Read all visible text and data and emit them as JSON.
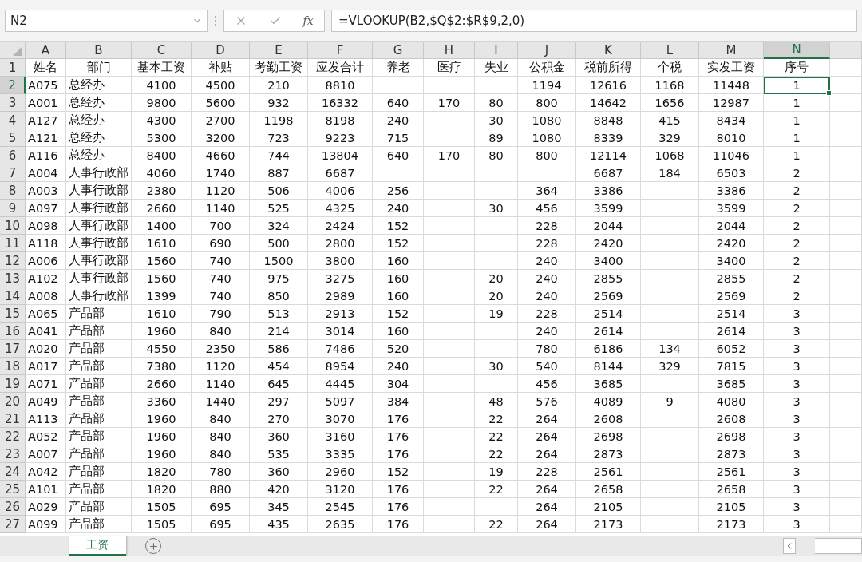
{
  "formula_bar": {
    "name_box": "N2",
    "fx": "fx",
    "formula": "=VLOOKUP(B2,$Q$2:$R$9,2,0)"
  },
  "columns": [
    {
      "letter": "A",
      "selected": false
    },
    {
      "letter": "B",
      "selected": false
    },
    {
      "letter": "C",
      "selected": false
    },
    {
      "letter": "D",
      "selected": false
    },
    {
      "letter": "E",
      "selected": false
    },
    {
      "letter": "F",
      "selected": false
    },
    {
      "letter": "G",
      "selected": false
    },
    {
      "letter": "H",
      "selected": false
    },
    {
      "letter": "I",
      "selected": false
    },
    {
      "letter": "J",
      "selected": false
    },
    {
      "letter": "K",
      "selected": false
    },
    {
      "letter": "L",
      "selected": false
    },
    {
      "letter": "M",
      "selected": false
    },
    {
      "letter": "N",
      "selected": true
    }
  ],
  "rows": [
    {
      "row_number": "1",
      "selected": false,
      "cells": [
        "姓名",
        "部门",
        "基本工资",
        "补贴",
        "考勤工资",
        "应发合计",
        "养老",
        "医疗",
        "失业",
        "公积金",
        "税前所得",
        "个税",
        "实发工资",
        "序号"
      ]
    },
    {
      "row_number": "2",
      "selected": true,
      "cells": [
        "A075",
        "总经办",
        "4100",
        "4500",
        "210",
        "8810",
        null,
        null,
        null,
        "1194",
        "12616",
        "1168",
        "11448",
        "1"
      ]
    },
    {
      "row_number": "3",
      "selected": false,
      "cells": [
        "A001",
        "总经办",
        "9800",
        "5600",
        "932",
        "16332",
        "640",
        "170",
        "80",
        "800",
        "14642",
        "1656",
        "12987",
        "1"
      ]
    },
    {
      "row_number": "4",
      "selected": false,
      "cells": [
        "A127",
        "总经办",
        "4300",
        "2700",
        "1198",
        "8198",
        "240",
        null,
        "30",
        "1080",
        "8848",
        "415",
        "8434",
        "1"
      ]
    },
    {
      "row_number": "5",
      "selected": false,
      "cells": [
        "A121",
        "总经办",
        "5300",
        "3200",
        "723",
        "9223",
        "715",
        null,
        "89",
        "1080",
        "8339",
        "329",
        "8010",
        "1"
      ]
    },
    {
      "row_number": "6",
      "selected": false,
      "cells": [
        "A116",
        "总经办",
        "8400",
        "4660",
        "744",
        "13804",
        "640",
        "170",
        "80",
        "800",
        "12114",
        "1068",
        "11046",
        "1"
      ]
    },
    {
      "row_number": "7",
      "selected": false,
      "cells": [
        "A004",
        "人事行政部",
        "4060",
        "1740",
        "887",
        "6687",
        null,
        null,
        null,
        null,
        "6687",
        "184",
        "6503",
        "2"
      ]
    },
    {
      "row_number": "8",
      "selected": false,
      "cells": [
        "A003",
        "人事行政部",
        "2380",
        "1120",
        "506",
        "4006",
        "256",
        null,
        null,
        "364",
        "3386",
        null,
        "3386",
        "2"
      ]
    },
    {
      "row_number": "9",
      "selected": false,
      "cells": [
        "A097",
        "人事行政部",
        "2660",
        "1140",
        "525",
        "4325",
        "240",
        null,
        "30",
        "456",
        "3599",
        null,
        "3599",
        "2"
      ]
    },
    {
      "row_number": "10",
      "selected": false,
      "cells": [
        "A098",
        "人事行政部",
        "1400",
        "700",
        "324",
        "2424",
        "152",
        null,
        null,
        "228",
        "2044",
        null,
        "2044",
        "2"
      ]
    },
    {
      "row_number": "11",
      "selected": false,
      "cells": [
        "A118",
        "人事行政部",
        "1610",
        "690",
        "500",
        "2800",
        "152",
        null,
        null,
        "228",
        "2420",
        null,
        "2420",
        "2"
      ]
    },
    {
      "row_number": "12",
      "selected": false,
      "cells": [
        "A006",
        "人事行政部",
        "1560",
        "740",
        "1500",
        "3800",
        "160",
        null,
        null,
        "240",
        "3400",
        null,
        "3400",
        "2"
      ]
    },
    {
      "row_number": "13",
      "selected": false,
      "cells": [
        "A102",
        "人事行政部",
        "1560",
        "740",
        "975",
        "3275",
        "160",
        null,
        "20",
        "240",
        "2855",
        null,
        "2855",
        "2"
      ]
    },
    {
      "row_number": "14",
      "selected": false,
      "cells": [
        "A008",
        "人事行政部",
        "1399",
        "740",
        "850",
        "2989",
        "160",
        null,
        "20",
        "240",
        "2569",
        null,
        "2569",
        "2"
      ]
    },
    {
      "row_number": "15",
      "selected": false,
      "cells": [
        "A065",
        "产品部",
        "1610",
        "790",
        "513",
        "2913",
        "152",
        null,
        "19",
        "228",
        "2514",
        null,
        "2514",
        "3"
      ]
    },
    {
      "row_number": "16",
      "selected": false,
      "cells": [
        "A041",
        "产品部",
        "1960",
        "840",
        "214",
        "3014",
        "160",
        null,
        null,
        "240",
        "2614",
        null,
        "2614",
        "3"
      ]
    },
    {
      "row_number": "17",
      "selected": false,
      "cells": [
        "A020",
        "产品部",
        "4550",
        "2350",
        "586",
        "7486",
        "520",
        null,
        null,
        "780",
        "6186",
        "134",
        "6052",
        "3"
      ]
    },
    {
      "row_number": "18",
      "selected": false,
      "cells": [
        "A017",
        "产品部",
        "7380",
        "1120",
        "454",
        "8954",
        "240",
        null,
        "30",
        "540",
        "8144",
        "329",
        "7815",
        "3"
      ]
    },
    {
      "row_number": "19",
      "selected": false,
      "cells": [
        "A071",
        "产品部",
        "2660",
        "1140",
        "645",
        "4445",
        "304",
        null,
        null,
        "456",
        "3685",
        null,
        "3685",
        "3"
      ]
    },
    {
      "row_number": "20",
      "selected": false,
      "cells": [
        "A049",
        "产品部",
        "3360",
        "1440",
        "297",
        "5097",
        "384",
        null,
        "48",
        "576",
        "4089",
        "9",
        "4080",
        "3"
      ]
    },
    {
      "row_number": "21",
      "selected": false,
      "cells": [
        "A113",
        "产品部",
        "1960",
        "840",
        "270",
        "3070",
        "176",
        null,
        "22",
        "264",
        "2608",
        null,
        "2608",
        "3"
      ]
    },
    {
      "row_number": "22",
      "selected": false,
      "cells": [
        "A052",
        "产品部",
        "1960",
        "840",
        "360",
        "3160",
        "176",
        null,
        "22",
        "264",
        "2698",
        null,
        "2698",
        "3"
      ]
    },
    {
      "row_number": "23",
      "selected": false,
      "cells": [
        "A007",
        "产品部",
        "1960",
        "840",
        "535",
        "3335",
        "176",
        null,
        "22",
        "264",
        "2873",
        null,
        "2873",
        "3"
      ]
    },
    {
      "row_number": "24",
      "selected": false,
      "cells": [
        "A042",
        "产品部",
        "1820",
        "780",
        "360",
        "2960",
        "152",
        null,
        "19",
        "228",
        "2561",
        null,
        "2561",
        "3"
      ]
    },
    {
      "row_number": "25",
      "selected": false,
      "cells": [
        "A101",
        "产品部",
        "1820",
        "880",
        "420",
        "3120",
        "176",
        null,
        "22",
        "264",
        "2658",
        null,
        "2658",
        "3"
      ]
    },
    {
      "row_number": "26",
      "selected": false,
      "cells": [
        "A029",
        "产品部",
        "1505",
        "695",
        "345",
        "2545",
        "176",
        null,
        null,
        "264",
        "2105",
        null,
        "2105",
        "3"
      ]
    },
    {
      "row_number": "27",
      "selected": false,
      "cells": [
        "A099",
        "产品部",
        "1505",
        "695",
        "435",
        "2635",
        "176",
        null,
        "22",
        "264",
        "2173",
        null,
        "2173",
        "3"
      ]
    }
  ],
  "sheet_tabs": [
    {
      "label": "工资",
      "selected": true
    }
  ]
}
